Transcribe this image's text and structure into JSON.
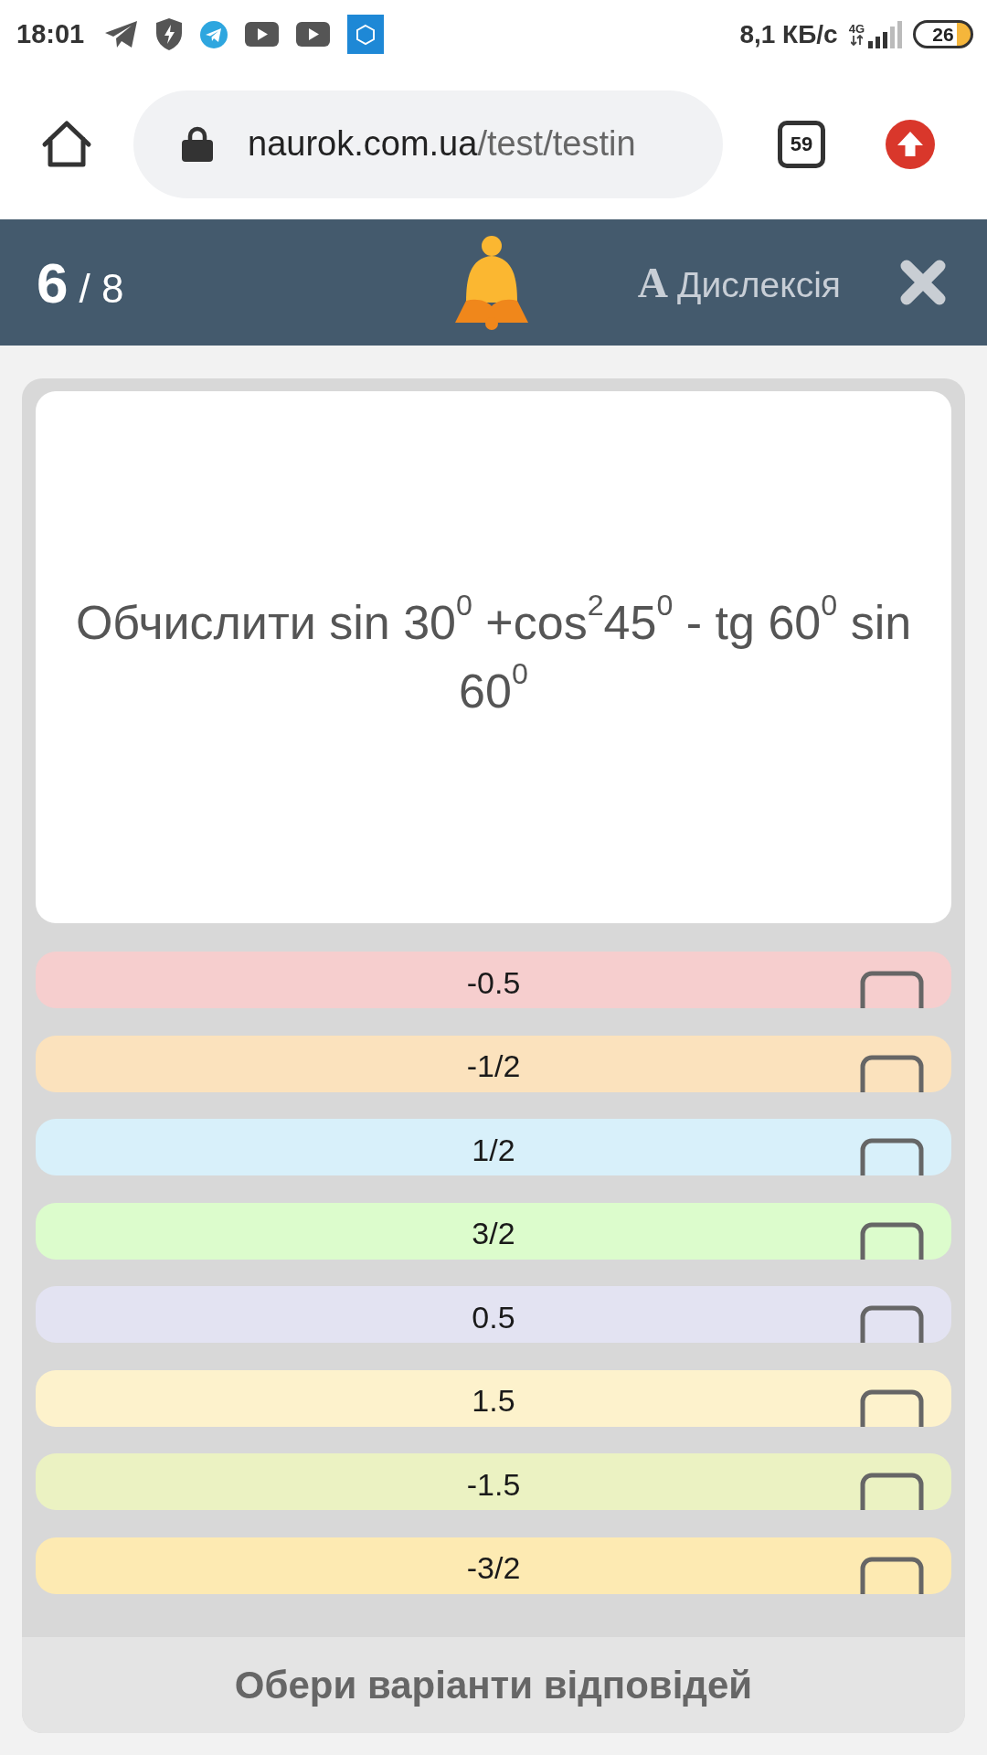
{
  "status_bar": {
    "time": "18:01",
    "speed": "8,1 КБ/с",
    "network": "4G",
    "battery": "26"
  },
  "browser": {
    "url_host": "naurok.com.ua",
    "url_path": "/test/testin",
    "tab_count": "59"
  },
  "header": {
    "counter_current": "6",
    "counter_total": "/ 8",
    "dyslexia": {
      "glyph": "A",
      "label": "Дислексія"
    }
  },
  "question": {
    "text": "Обчислити sin 30$^{0}$ +cos$^{2}$45$^{0}$ - tg 60$^{0}$ sin 60$^{0}$"
  },
  "options": [
    {
      "text": "-0.5",
      "color": "#f6cece",
      "checked": false
    },
    {
      "text": "-1/2",
      "color": "#fbe2bd",
      "checked": false
    },
    {
      "text": "1/2",
      "color": "#d8f0fa",
      "checked": false
    },
    {
      "text": "3/2",
      "color": "#dcfccc",
      "checked": false
    },
    {
      "text": "0.5",
      "color": "#e3e3f2",
      "checked": false
    },
    {
      "text": "1.5",
      "color": "#fdf2cc",
      "checked": false
    },
    {
      "text": "-1.5",
      "color": "#ebf2c2",
      "checked": false
    },
    {
      "text": "-3/2",
      "color": "#fdeab2",
      "checked": false
    }
  ],
  "footer": {
    "prompt": "Обери варіанти відповідей"
  }
}
